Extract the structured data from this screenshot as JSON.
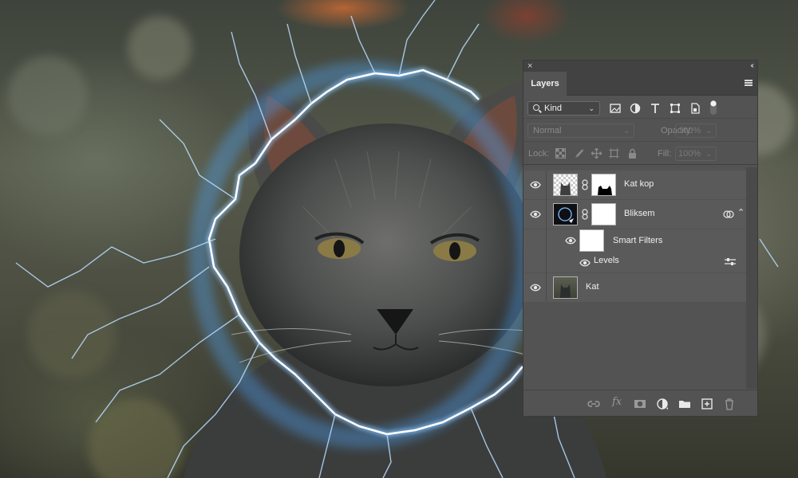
{
  "panel": {
    "title": "Layers",
    "close_glyph": "×",
    "collapse_glyph": "‹‹",
    "filter": {
      "kind_label": "Kind",
      "icons": [
        "pixel-filter-icon",
        "adjustment-filter-icon",
        "type-filter-icon",
        "shape-filter-icon",
        "smart-object-filter-icon",
        "filter-toggle-icon"
      ]
    },
    "blend_mode": "Normal",
    "opacity_label": "Opacity:",
    "opacity_value": "100%",
    "lock_label": "Lock:",
    "fill_label": "Fill:",
    "fill_value": "100%",
    "layers": [
      {
        "name": "Kat kop",
        "visible": true,
        "has_mask": true
      },
      {
        "name": "Bliksem",
        "visible": true,
        "has_mask": true,
        "smart_object": true,
        "smart_filters": {
          "label": "Smart Filters",
          "filters": [
            "Levels"
          ]
        }
      },
      {
        "name": "Kat",
        "visible": true,
        "has_mask": false
      }
    ],
    "footer_icons": [
      "link-layers-icon",
      "fx-icon",
      "add-mask-icon",
      "new-adjustment-icon",
      "new-group-icon",
      "new-layer-icon",
      "delete-layer-icon"
    ],
    "fx_label": "fx"
  },
  "colors": {
    "panel_bg": "#535353",
    "row_bg": "#5a5a5a",
    "lightning": "#ffffff",
    "glow": "#4fa8ff"
  }
}
